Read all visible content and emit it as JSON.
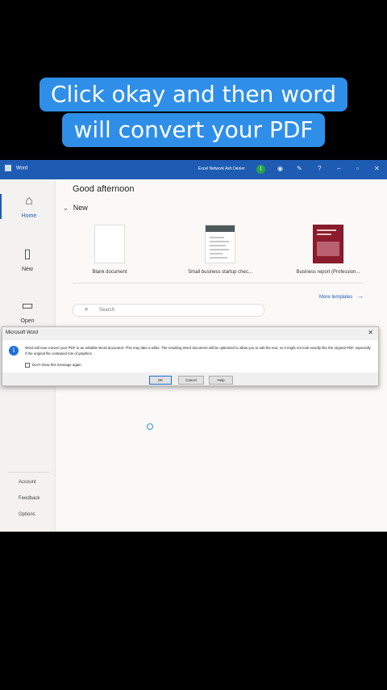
{
  "caption": {
    "line1": "Click okay and then word",
    "line2": "will convert your PDF"
  },
  "titlebar": {
    "app_name": "Word",
    "user_name": "Excel Network Ash Denier",
    "avatar_initial": "I",
    "icons": [
      "bulb-icon",
      "pen-icon",
      "help-icon",
      "minimize-icon",
      "maximize-icon",
      "close-icon"
    ]
  },
  "sidebar": {
    "items": [
      {
        "label": "Home",
        "icon": "home-icon"
      },
      {
        "label": "New",
        "icon": "new-document-icon"
      },
      {
        "label": "Open",
        "icon": "folder-icon"
      }
    ],
    "footer": [
      "Account",
      "Feedback",
      "Options"
    ]
  },
  "main": {
    "greeting": "Good afternoon",
    "new_header": "New",
    "templates": [
      {
        "label": "Blank document"
      },
      {
        "label": "Small business startup chec..."
      },
      {
        "label": "Business report (Profession..."
      }
    ],
    "more_templates": "More templates",
    "search_placeholder": "Search"
  },
  "dialog": {
    "title": "Microsoft Word",
    "message": "Word will now convert your PDF to an editable Word document. This may take a while. The resulting Word document will be optimized to allow you to edit the text, so it might not look exactly like the original PDF, especially if the original file contained lots of graphics.",
    "checkbox_label": "Don't show this message again",
    "buttons": {
      "ok": "OK",
      "cancel": "Cancel",
      "help": "Help"
    }
  },
  "colors": {
    "accent": "#1e5cb3",
    "caption_bg": "#2f8fe8"
  }
}
